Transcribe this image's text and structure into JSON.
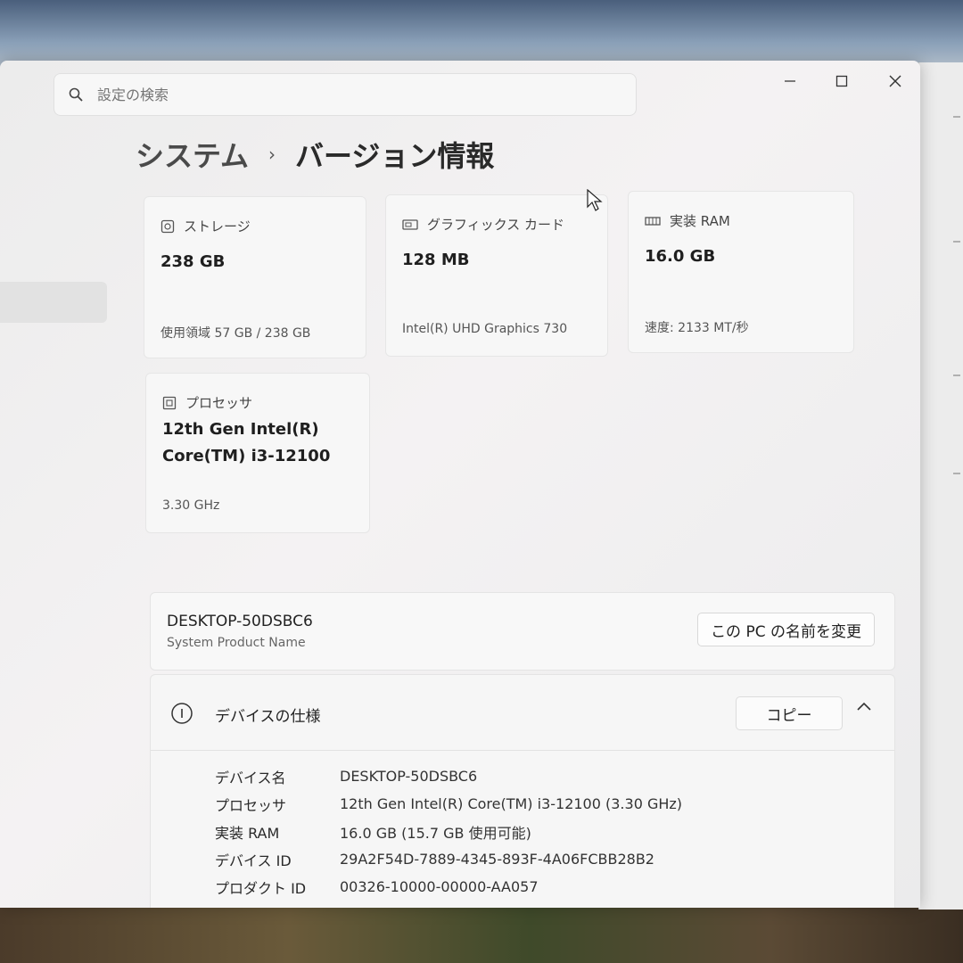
{
  "search": {
    "placeholder": "設定の検索"
  },
  "breadcrumb": {
    "parent": "システム",
    "separator": "›",
    "current": "バージョン情報"
  },
  "cards": {
    "storage": {
      "label": "ストレージ",
      "value": "238 GB",
      "sub": "使用領域 57 GB / 238 GB"
    },
    "graphics": {
      "label": "グラフィックス カード",
      "value": "128 MB",
      "sub": "Intel(R) UHD Graphics 730"
    },
    "ram": {
      "label": "実装 RAM",
      "value": "16.0 GB",
      "sub": "速度: 2133 MT/秒"
    },
    "cpu": {
      "label": "プロセッサ",
      "value_line1": "12th Gen Intel(R)",
      "value_line2": "Core(TM) i3-12100",
      "sub": "3.30 GHz"
    }
  },
  "pc": {
    "name": "DESKTOP-50DSBC6",
    "sub": "System Product Name",
    "rename_label": "この PC の名前を変更"
  },
  "device_spec": {
    "title": "デバイスの仕様",
    "copy_label": "コピー",
    "rows": [
      {
        "key": "デバイス名",
        "value": "DESKTOP-50DSBC6"
      },
      {
        "key": "プロセッサ",
        "value": "12th Gen Intel(R) Core(TM) i3-12100 (3.30 GHz)"
      },
      {
        "key": "実装 RAM",
        "value": "16.0 GB (15.7 GB 使用可能)"
      },
      {
        "key": "デバイス ID",
        "value": "29A2F54D-7889-4345-893F-4A06FCBB28B2"
      },
      {
        "key": "プロダクト ID",
        "value": "00326-10000-00000-AA057"
      }
    ]
  },
  "colors": {
    "window_bg": "#ededed",
    "card_bg": "#f7f7f7",
    "text": "#222222"
  }
}
